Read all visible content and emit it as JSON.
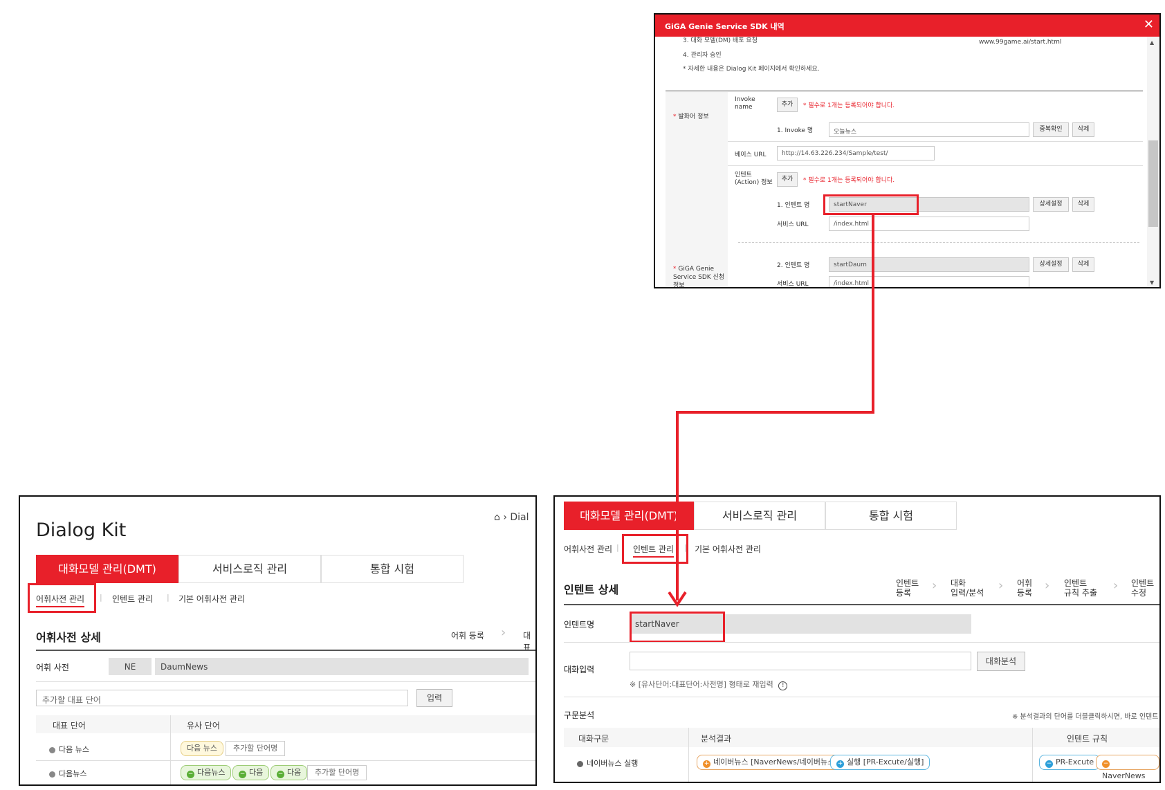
{
  "popup": {
    "title": "GiGA Genie Service SDK 내역",
    "close_label": "✕",
    "steps": [
      "3. 대화 모델(DM) 배포 요청",
      "4. 관리자 승인",
      "* 자세한 내용은 Dialog Kit 페이지에서 확인하세요."
    ],
    "url_text": "www.99game.ai/start.html",
    "utterance_label": "발화어 정보",
    "required_mark": "*",
    "invoke_label": "Invoke name",
    "add_button": "추가",
    "required_note": "* 필수로 1개는 등록되어야 합니다.",
    "invoke_item_label": "1. Invoke 명",
    "invoke_value": "오늘뉴스",
    "dup_check_button": "중복확인",
    "delete_button": "삭제",
    "base_url_label": "베이스 URL",
    "base_url_value": "http://14.63.226.234/Sample/test/",
    "intent_label": "인텐트 (Action) 정보",
    "intent1_label": "1. 인텐트 명",
    "intent1_value": "startNaver",
    "detail_button": "상세설정",
    "service_url_label": "서비스 URL",
    "service_url_value": "/index.html",
    "intent2_label": "2. 인텐트 명",
    "intent2_value": "startDaum",
    "service_url2_value": "/index.html",
    "sdk_label": "GiGA Genie Service SDK 신청 정보"
  },
  "dialogkit": {
    "breadcrumb": "Dial",
    "title": "Dialog Kit",
    "tabs": [
      "대화모델 관리(DMT)",
      "서비스로직 관리",
      "통합 시험"
    ],
    "subnav": [
      "어휘사전 관리",
      "인텐트 관리",
      "기본 어휘사전 관리"
    ],
    "section_title": "어휘사전 상세",
    "steps": [
      "어휘 등록",
      "대표"
    ],
    "dict_label": "어휘 사전",
    "dict_type": "NE",
    "dict_name": "DaumNews",
    "add_placeholder": "추가할 대표 단어",
    "input_button": "입력",
    "table_headers": [
      "대표 단어",
      "유사 단어"
    ],
    "rows": [
      {
        "word": "다음 뉴스",
        "chips": [
          "다음 뉴스"
        ],
        "add": "추가할 단어명"
      },
      {
        "word": "다음뉴스",
        "chips": [
          "다음뉴스",
          "다음",
          "다옴"
        ],
        "add": "추가할 단어명"
      }
    ]
  },
  "intent": {
    "tabs": [
      "대화모델 관리(DMT)",
      "서비스로직 관리",
      "통합 시험"
    ],
    "subnav": [
      "어휘사전 관리",
      "인텐트 관리",
      "기본 어휘사전 관리"
    ],
    "section_title": "인텐트 상세",
    "steps": [
      [
        "인텐트",
        "등록"
      ],
      [
        "대화",
        "입력/분석"
      ],
      [
        "어휘",
        "등록"
      ],
      [
        "인텐트",
        "규칙 추출"
      ],
      [
        "인텐트",
        "수정"
      ]
    ],
    "name_label": "인텐트명",
    "name_value": "startNaver",
    "dialog_label": "대화입력",
    "analyze_button": "대화분석",
    "hint": "※ [유사단어:대표단어:사전명] 형태로 재입력",
    "info_icon": "!",
    "parse_label": "구문분석",
    "parse_note": "※ 분석결과의 단어를 더블클릭하시면, 바로 인텐트",
    "table_headers": [
      "대화구문",
      "분석결과",
      "인텐트 규칙"
    ],
    "row": {
      "phrase": "네이버뉴스 실행",
      "result_chips": [
        "네이버뉴스 [NaverNews/네이버뉴스]",
        "실행 [PR-Excute/실행]"
      ],
      "rule_chips": [
        "PR-Excute",
        "NaverNews"
      ]
    }
  },
  "colors": {
    "accent": "#e8202a"
  }
}
